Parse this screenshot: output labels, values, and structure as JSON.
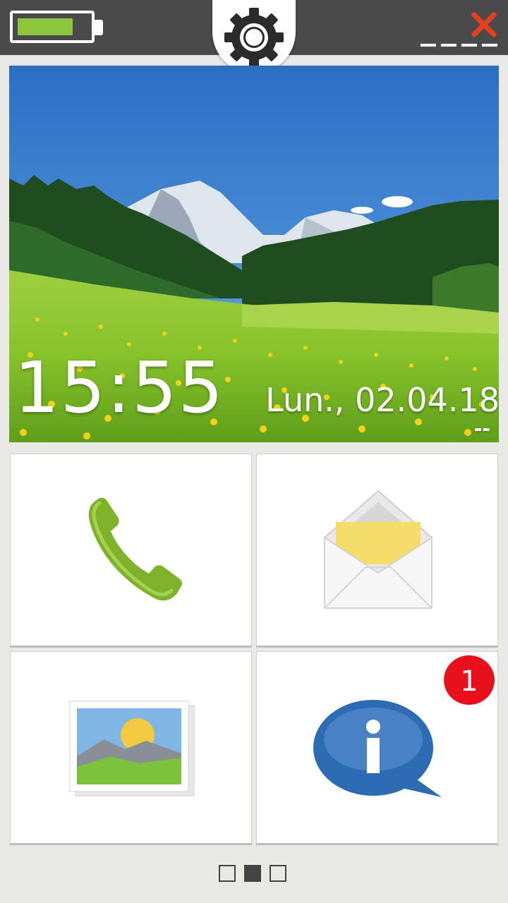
{
  "status_bar": {
    "battery_level": 0.8,
    "battery_color": "#8cc63e",
    "settings_icon": "gear-icon",
    "close_icon": "close-icon",
    "close_color": "#e8401c"
  },
  "home": {
    "time": "15:55",
    "date": "Lun., 02.04.18",
    "weather": "--"
  },
  "tiles": [
    {
      "name": "phone",
      "icon": "phone-icon"
    },
    {
      "name": "messages",
      "icon": "envelope-icon"
    },
    {
      "name": "gallery",
      "icon": "picture-icon"
    },
    {
      "name": "info",
      "icon": "info-icon",
      "badge": "1",
      "badge_color": "#e8101a"
    }
  ],
  "pager": {
    "pages": 3,
    "current_index": 1
  }
}
